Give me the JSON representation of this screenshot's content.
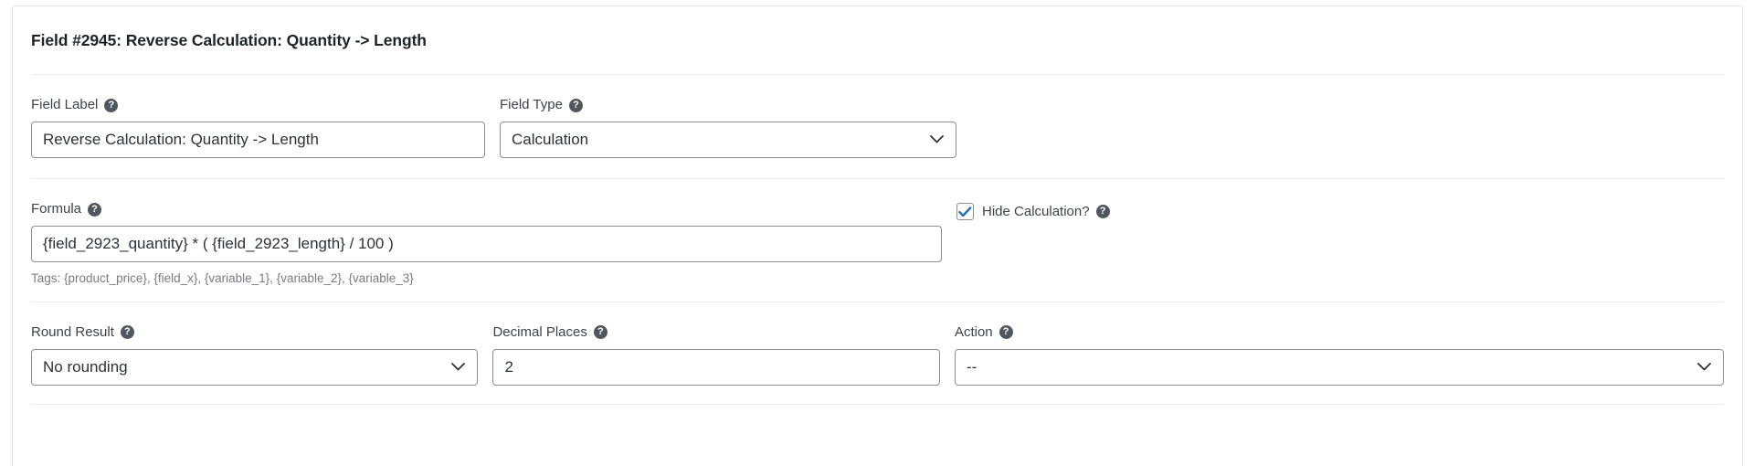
{
  "panel": {
    "title": "Field #2945: Reverse Calculation: Quantity -> Length"
  },
  "help_glyph": "?",
  "fields": {
    "field_label": {
      "label": "Field Label",
      "help_icon": "help-icon",
      "value": "Reverse Calculation: Quantity -> Length",
      "placeholder": ""
    },
    "field_type": {
      "label": "Field Type",
      "help_icon": "help-icon",
      "value": "Calculation",
      "arrow_icon": "chevron-down-icon"
    },
    "formula": {
      "label": "Formula",
      "help_icon": "help-icon",
      "value": "{field_2923_quantity} * ( {field_2923_length} / 100 )",
      "placeholder": "",
      "hint": "Tags: {product_price}, {field_x}, {variable_1}, {variable_2}, {variable_3}"
    },
    "hide_calculation": {
      "label": "Hide Calculation?",
      "help_icon": "help-icon",
      "checked": true,
      "check_glyph": "✓",
      "check_color": "#2271b1"
    },
    "round_result": {
      "label": "Round Result",
      "help_icon": "help-icon",
      "value": "No rounding",
      "arrow_icon": "chevron-down-icon"
    },
    "decimal_places": {
      "label": "Decimal Places",
      "help_icon": "help-icon",
      "value": "2",
      "placeholder": ""
    },
    "action": {
      "label": "Action",
      "help_icon": "help-icon",
      "value": "--",
      "arrow_icon": "chevron-down-icon"
    }
  },
  "colors": {
    "panel_border": "#e2e4e7",
    "input_border": "#8c8f94",
    "text": "#2c3338",
    "label_text": "#3c434a",
    "hint_text": "#787c82",
    "accent": "#2271b1"
  }
}
